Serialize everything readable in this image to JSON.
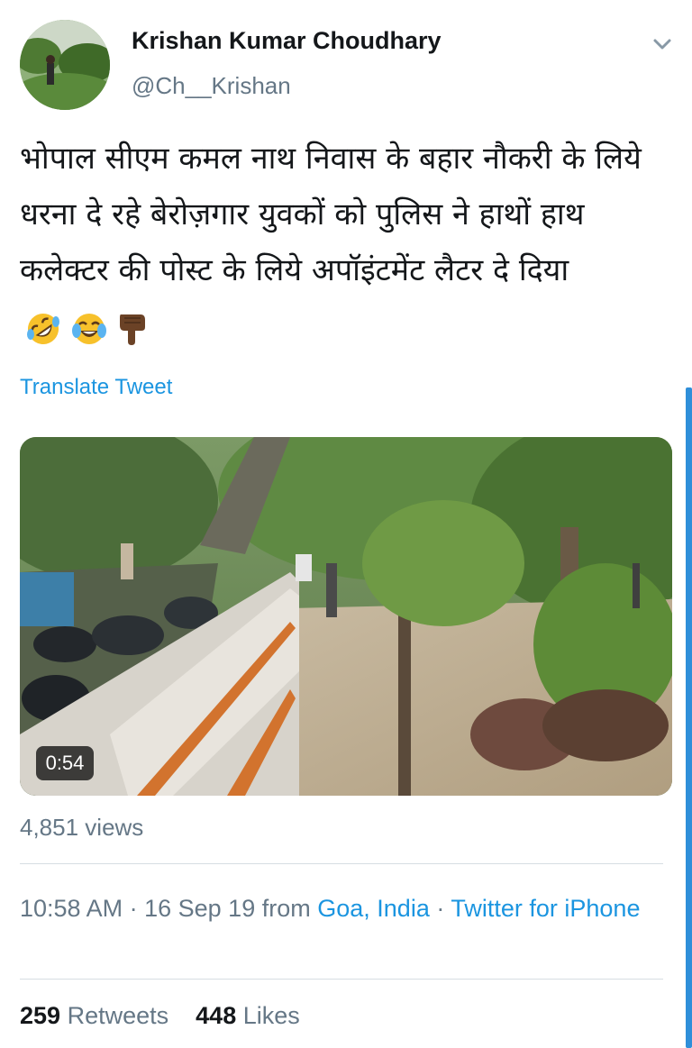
{
  "author": {
    "display_name": "Krishan Kumar Choudhary",
    "handle": "@Ch__Krishan"
  },
  "tweet": {
    "text": "भोपाल सीएम कमल नाथ निवास के बहार नौकरी के लिये धरना दे रहे बेरोज़गार युवकों को पुलिस ने हाथों हाथ कलेक्टर की पोस्ट के लिये अपॉइंटमेंट लैटर दे दिया",
    "emojis": [
      "rolling-on-floor-laughing-emoji",
      "tears-of-joy-emoji",
      "backhand-pointing-down-emoji"
    ],
    "translate_label": "Translate Tweet"
  },
  "media": {
    "duration": "0:54"
  },
  "views": "4,851 views",
  "meta": {
    "time": "10:58 AM",
    "sep1": "·",
    "date": "16 Sep 19",
    "from_label": "from",
    "location": "Goa, India",
    "sep2": "·",
    "source": "Twitter for iPhone"
  },
  "stats": {
    "retweets_count": "259",
    "retweets_label": "Retweets",
    "likes_count": "448",
    "likes_label": "Likes"
  },
  "colors": {
    "link": "#1b95e0",
    "secondary_text": "#657786",
    "primary_text": "#14171a",
    "scrollbar": "#2f8fd9"
  }
}
